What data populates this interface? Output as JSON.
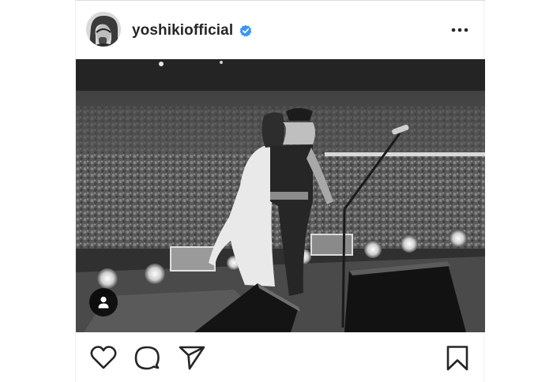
{
  "post": {
    "username": "yoshikiofficial",
    "verified": true,
    "icons": {
      "avatar": "profile-photo",
      "verified": "verified-badge-icon",
      "more": "more-options-icon",
      "tag": "user-tag-icon",
      "like": "heart-icon",
      "comment": "comment-icon",
      "share": "paper-plane-icon",
      "save": "bookmark-icon"
    }
  },
  "colors": {
    "text": "#262626",
    "verified_badge": "#3897f0",
    "border": "#dbdbdb"
  }
}
